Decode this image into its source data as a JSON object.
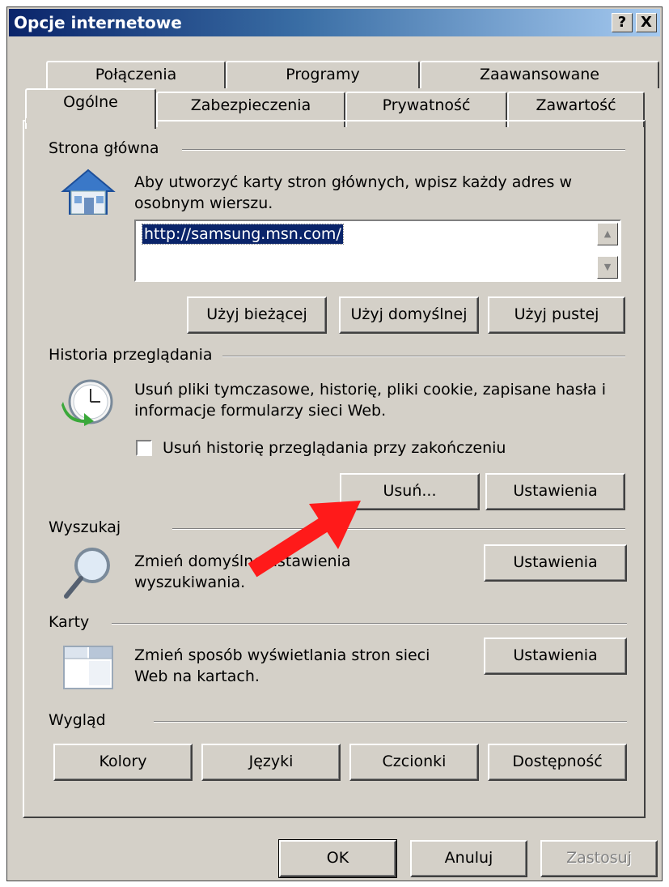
{
  "window": {
    "title": "Opcje internetowe",
    "help_glyph": "?",
    "close_glyph": "X"
  },
  "tabs_back": [
    "Połączenia",
    "Programy",
    "Zaawansowane"
  ],
  "tabs_front": [
    "Ogólne",
    "Zabezpieczenia",
    "Prywatność",
    "Zawartość"
  ],
  "active_tab": "Ogólne",
  "home": {
    "label": "Strona główna",
    "desc_line1": "Aby utworzyć karty stron głównych, wpisz każdy adres w",
    "desc_line2": "osobnym wierszu.",
    "url": "http://samsung.msn.com/",
    "btn_current": "Użyj bieżącej",
    "btn_default": "Użyj domyślnej",
    "btn_blank": "Użyj pustej"
  },
  "history": {
    "label": "Historia przeglądania",
    "desc_line1": "Usuń pliki tymczasowe, historię, pliki cookie, zapisane hasła i",
    "desc_line2": "informacje formularzy sieci Web.",
    "checkbox_label": "Usuń historię przeglądania przy zakończeniu",
    "checkbox_checked": false,
    "btn_delete": "Usuń...",
    "btn_settings": "Ustawienia"
  },
  "search": {
    "label": "Wyszukaj",
    "desc_line1": "Zmień domyślne ustawienia",
    "desc_line2": "wyszukiwania.",
    "btn_settings": "Ustawienia"
  },
  "tabs_section": {
    "label": "Karty",
    "desc_line1": "Zmień sposób wyświetlania stron sieci",
    "desc_line2": "Web na kartach.",
    "btn_settings": "Ustawienia"
  },
  "appearance": {
    "label": "Wygląd",
    "btn_colors": "Kolory",
    "btn_languages": "Języki",
    "btn_fonts": "Czcionki",
    "btn_accessibility": "Dostępność"
  },
  "footer": {
    "ok": "OK",
    "cancel": "Anuluj",
    "apply": "Zastosuj"
  },
  "colors": {
    "title_bar": "#0a246a",
    "dialog_bg": "#d4d0c8",
    "annotation_arrow": "#ff1a1a"
  }
}
